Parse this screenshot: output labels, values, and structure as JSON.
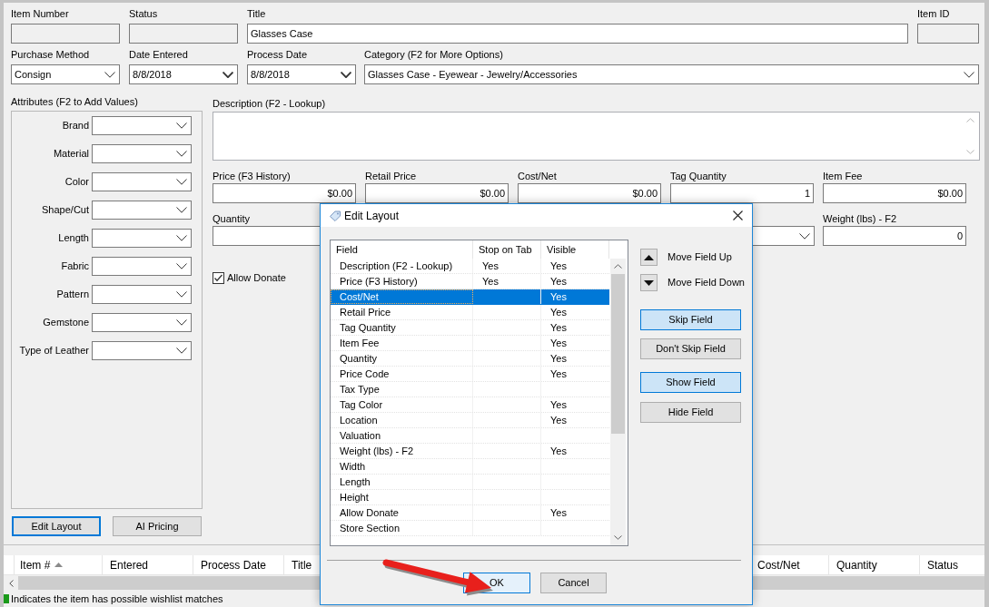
{
  "header_fields": [
    {
      "label": "Item Number",
      "kind": "readonly"
    },
    {
      "label": "Status",
      "kind": "readonly"
    },
    {
      "label": "Title",
      "kind": "text",
      "value": "Glasses Case"
    },
    {
      "label": "Item ID",
      "kind": "readonly"
    }
  ],
  "selection_fields": [
    {
      "label": "Purchase Method",
      "kind": "select",
      "value": "Consign"
    },
    {
      "label": "Date Entered",
      "kind": "date",
      "value": "8/8/2018"
    },
    {
      "label": "Process Date",
      "kind": "date",
      "value": "8/8/2018"
    },
    {
      "label": "Category (F2 for More Options)",
      "kind": "select",
      "value": "Glasses Case - Eyewear - Jewelry/Accessories"
    }
  ],
  "attributes": {
    "title": "Attributes (F2 to Add Values)",
    "fields": [
      {
        "label": "Brand"
      },
      {
        "label": "Material"
      },
      {
        "label": "Color"
      },
      {
        "label": "Shape/Cut"
      },
      {
        "label": "Length"
      },
      {
        "label": "Fabric"
      },
      {
        "label": "Pattern"
      },
      {
        "label": "Gemstone"
      },
      {
        "label": "Type of Leather"
      }
    ]
  },
  "panel_buttons": [
    {
      "label": "Edit Layout",
      "focused": true
    },
    {
      "label": "AI Pricing",
      "focused": false
    }
  ],
  "description": {
    "label": "Description (F2 - Lookup)"
  },
  "price_fields": [
    {
      "label": "Price (F3 History)",
      "kind": "text",
      "value": "$0.00"
    },
    {
      "label": "Retail Price",
      "kind": "text",
      "value": "$0.00"
    },
    {
      "label": "Cost/Net",
      "kind": "text",
      "value": "$0.00"
    },
    {
      "label": "Tag Quantity",
      "kind": "text",
      "value": "1"
    },
    {
      "label": "Item Fee",
      "kind": "text",
      "value": "$0.00"
    }
  ],
  "detail_fields": [
    {
      "label": "Quantity",
      "kind": "text"
    },
    {
      "kind": "select"
    },
    {
      "label": "Weight (lbs) - F2",
      "kind": "text",
      "value": "0"
    }
  ],
  "allow_donate": {
    "label": "Allow Donate",
    "checked": true
  },
  "grid": {
    "columns": [
      {
        "label": "Item #",
        "sorted": true
      },
      {
        "label": "Entered",
        "sorted": false
      },
      {
        "label": "Process Date",
        "sorted": false
      },
      {
        "label": "Title",
        "sorted": false
      },
      {
        "label": "Cost/Net",
        "sorted": false
      },
      {
        "label": "Quantity",
        "sorted": false
      },
      {
        "label": "Status",
        "sorted": false
      }
    ]
  },
  "status_bar": {
    "text": "Indicates the item has possible wishlist matches"
  },
  "dialog": {
    "title": "Edit Layout",
    "columns": [
      "Field",
      "Stop on Tab",
      "Visible"
    ],
    "rows": [
      {
        "field": "Description (F2 - Lookup)",
        "stop_on_tab": "Yes",
        "visible": "Yes",
        "selected": false
      },
      {
        "field": "Price (F3 History)",
        "stop_on_tab": "Yes",
        "visible": "Yes",
        "selected": false
      },
      {
        "field": "Cost/Net",
        "visible": "Yes",
        "selected": true
      },
      {
        "field": "Retail Price",
        "visible": "Yes",
        "selected": false
      },
      {
        "field": "Tag Quantity",
        "visible": "Yes",
        "selected": false
      },
      {
        "field": "Item Fee",
        "visible": "Yes",
        "selected": false
      },
      {
        "field": "Quantity",
        "visible": "Yes",
        "selected": false
      },
      {
        "field": "Price Code",
        "visible": "Yes",
        "selected": false
      },
      {
        "field": "Tax Type",
        "selected": false
      },
      {
        "field": "Tag Color",
        "visible": "Yes",
        "selected": false
      },
      {
        "field": "Location",
        "visible": "Yes",
        "selected": false
      },
      {
        "field": "Valuation",
        "selected": false
      },
      {
        "field": "Weight (lbs) - F2",
        "visible": "Yes",
        "selected": false
      },
      {
        "field": "Width",
        "selected": false
      },
      {
        "field": "Length",
        "selected": false
      },
      {
        "field": "Height",
        "selected": false
      },
      {
        "field": "Allow Donate",
        "visible": "Yes",
        "selected": false
      },
      {
        "field": "Store Section",
        "selected": false
      }
    ],
    "move_buttons": [
      {
        "label": "Move Field Up",
        "kind": "up"
      },
      {
        "label": "Move Field Down",
        "kind": "down"
      }
    ],
    "action_buttons": [
      {
        "label": "Skip Field",
        "highlighted": true
      },
      {
        "label": "Don't Skip Field",
        "highlighted": false
      },
      {
        "label": "Show Field",
        "highlighted": true
      },
      {
        "label": "Hide Field",
        "highlighted": false
      }
    ],
    "footer_buttons": [
      {
        "label": "OK",
        "default": true
      },
      {
        "label": "Cancel",
        "default": false
      }
    ]
  }
}
